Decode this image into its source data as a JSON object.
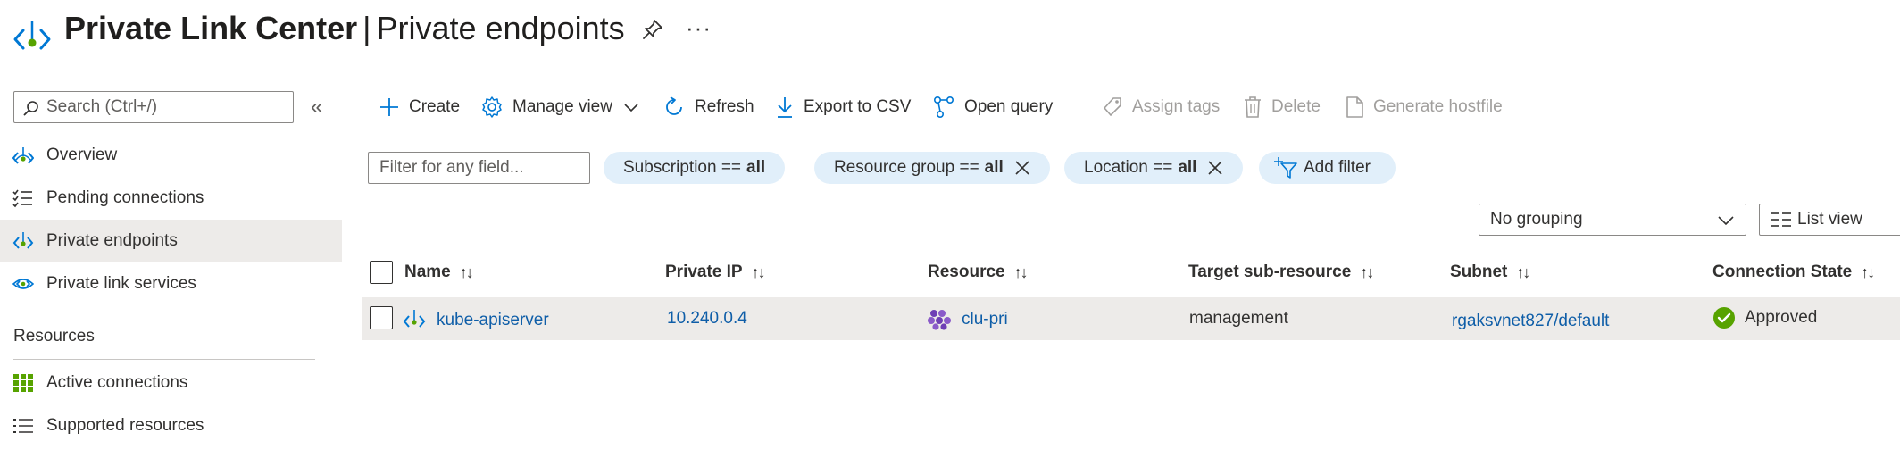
{
  "header": {
    "title_strong": "Private Link Center",
    "title_sep": "|",
    "title_page": "Private endpoints",
    "more": "···"
  },
  "sidebar": {
    "search_placeholder": "Search (Ctrl+/)",
    "collapse": "«",
    "items": [
      {
        "label": "Overview",
        "icon": "overview-icon"
      },
      {
        "label": "Pending connections",
        "icon": "checklist-icon"
      },
      {
        "label": "Private endpoints",
        "icon": "private-endpoint-icon",
        "active": true
      },
      {
        "label": "Private link services",
        "icon": "private-link-service-icon"
      }
    ],
    "section_label": "Resources",
    "resource_items": [
      {
        "label": "Active connections",
        "icon": "grid-icon"
      },
      {
        "label": "Supported resources",
        "icon": "list-icon"
      }
    ]
  },
  "toolbar": {
    "create": "Create",
    "manage_view": "Manage view",
    "refresh": "Refresh",
    "export": "Export to CSV",
    "open_query": "Open query",
    "assign_tags": "Assign tags",
    "delete": "Delete",
    "generate_hostfile": "Generate hostfile"
  },
  "filters": {
    "placeholder": "Filter for any field...",
    "subscription_label": "Subscription ==",
    "subscription_value": "all",
    "resource_group_label": "Resource group ==",
    "resource_group_value": "all",
    "location_label": "Location ==",
    "location_value": "all",
    "add_filter": "Add filter"
  },
  "grouping": {
    "selected": "No grouping",
    "view": "List view"
  },
  "table": {
    "columns": [
      "Name",
      "Private IP",
      "Resource",
      "Target sub-resource",
      "Subnet",
      "Connection State"
    ],
    "rows": [
      {
        "name": "kube-apiserver",
        "private_ip": "10.240.0.4",
        "resource": "clu-pri",
        "target": "management",
        "subnet": "rgaksvnet827/default",
        "state": "Approved"
      }
    ]
  },
  "colors": {
    "accent": "#0078d4",
    "link": "#0f5ea8",
    "pill_bg": "#e1effa",
    "approved": "#57a300",
    "active_bg": "#edebe9"
  }
}
